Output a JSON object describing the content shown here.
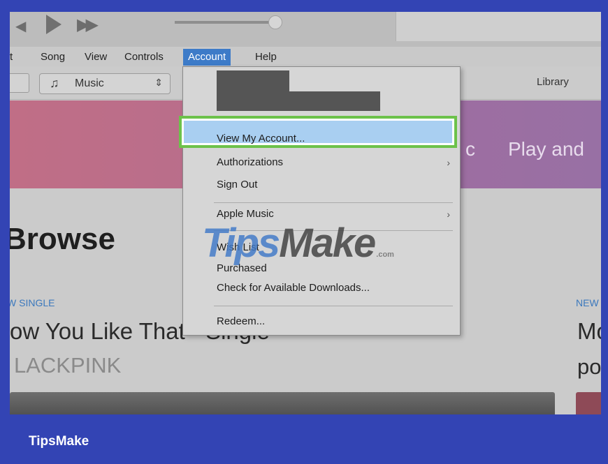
{
  "player": {
    "prev_icon": "rewind-icon",
    "play_icon": "play-icon",
    "ff_icon": "fast-forward-icon"
  },
  "menubar": {
    "edit_tail": "t",
    "song": "Song",
    "view": "View",
    "controls": "Controls",
    "account": "Account",
    "help": "Help"
  },
  "toolbar": {
    "media_icon": "music-note-icon",
    "media_label": "Music",
    "library": "Library"
  },
  "banner": {
    "partial_letter": "c",
    "text": "Play and"
  },
  "content": {
    "browse_title": "Browse",
    "single_tag": "W SINGLE",
    "single_title": "ow You Like That - Single",
    "single_artist": "LACKPINK",
    "right_tag": "NEW",
    "right_title": "Mo",
    "right_title2": "po"
  },
  "account_menu": {
    "view_my_account": "View My Account...",
    "authorizations": "Authorizations",
    "sign_out": "Sign Out",
    "apple_music": "Apple Music",
    "wish_list": "Wish List",
    "purchased": "Purchased",
    "check_downloads": "Check for Available Downloads...",
    "redeem": "Redeem...",
    "submenu_arrow": "›"
  },
  "colors": {
    "frame_bg": "#3344b4",
    "menu_highlight": "#3d7bc8",
    "selection_outline": "#6cc24a",
    "selection_fill": "#a9cff1"
  },
  "watermark": {
    "tips": "Tips",
    "make": "Make",
    "com": ".com"
  },
  "footer": {
    "brand": "TipsMake"
  }
}
